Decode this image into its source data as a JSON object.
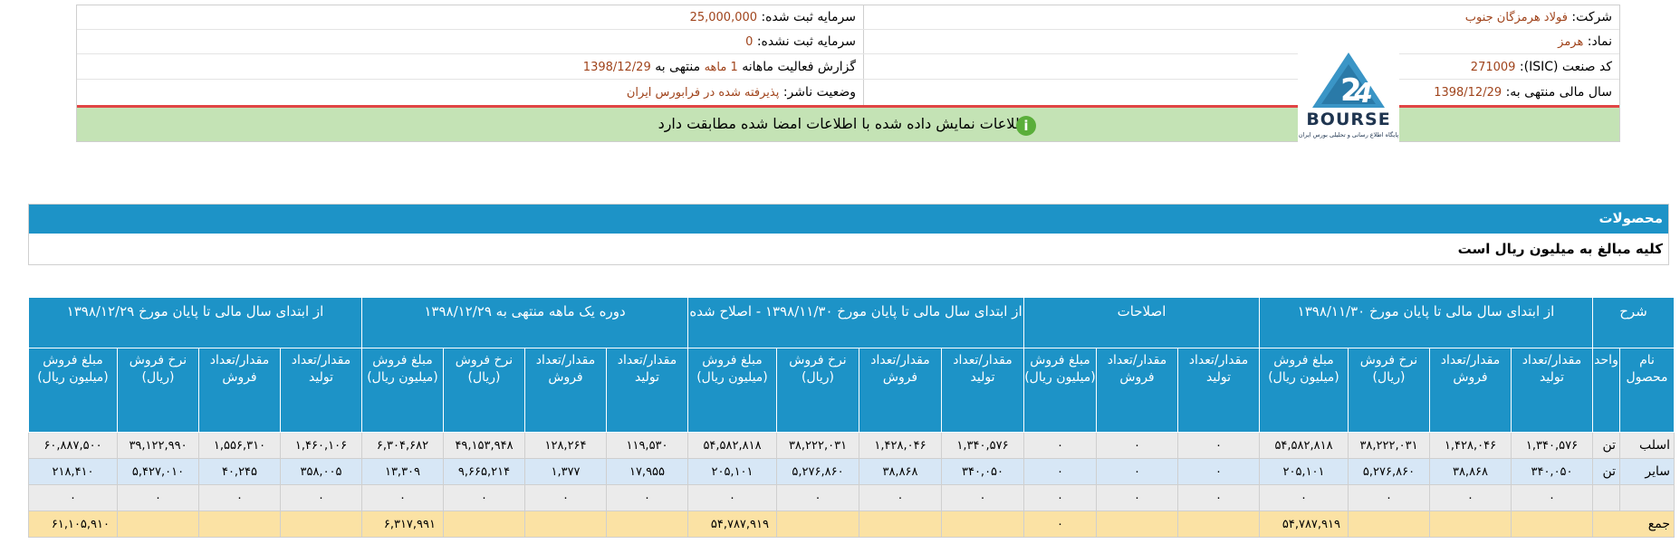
{
  "header": {
    "company_label": "شرکت:",
    "company_value": "فولاد هرمزگان جنوب",
    "symbol_label": "نماد:",
    "symbol_value": "هرمز",
    "isic_label": "کد صنعت (ISIC):",
    "isic_value": "271009",
    "fiscal_label": "سال مالی منتهی به:",
    "fiscal_value": "1398/12/29",
    "registered_capital_label": "سرمایه ثبت شده:",
    "registered_capital_value": "25,000,000",
    "unregistered_capital_label": "سرمایه ثبت نشده:",
    "unregistered_capital_value": "0",
    "report_prefix": "گزارش فعالیت ماهانه",
    "report_period": "1 ماهه",
    "report_mid": "منتهی به",
    "report_date": "1398/12/29",
    "publisher_label": "وضعیت ناشر:",
    "publisher_value": "پذیرفته شده در فرابورس ایران",
    "logo_text": "BOURSE",
    "logo_caption": "پایگاه اطلاع رسانی و تحلیلی بورس ایران",
    "notice": "اطلاعات نمایش داده شده با اطلاعات امضا شده مطابقت دارد",
    "notice_icon": "info-icon"
  },
  "products": {
    "title": "محصولات",
    "subtitle": "کلیه مبالغ به میلیون ریال است"
  },
  "colors": {
    "header_blue": "#1d93c7",
    "notice_green": "#c4e3b5",
    "accent_red": "#e04545",
    "value_brown": "#a0441c",
    "total_row": "#fbe2a4",
    "alt_row": "#d7e7f6"
  },
  "table": {
    "group_headers": [
      "شرح",
      "از ابتدای سال مالی تا پایان مورخ ۱۳۹۸/۱۱/۳۰",
      "اصلاحات",
      "از ابتدای سال مالی تا پایان مورخ ۱۳۹۸/۱۱/۳۰ - اصلاح شده",
      "دوره یک ماهه منتهی به ۱۳۹۸/۱۲/۲۹",
      "از ابتدای سال مالی تا پایان مورخ ۱۳۹۸/۱۲/۲۹"
    ],
    "sub_headers": [
      "نام محصول",
      "واحد",
      "مقدار/تعداد تولید",
      "مقدار/تعداد فروش",
      "نرخ فروش (ریال)",
      "مبلغ فروش (میلیون ریال)",
      "مقدار/تعداد تولید",
      "مقدار/تعداد فروش",
      "مبلغ فروش (میلیون ریال)",
      "مقدار/تعداد تولید",
      "مقدار/تعداد فروش",
      "نرخ فروش (ریال)",
      "مبلغ فروش (میلیون ریال)",
      "مقدار/تعداد تولید",
      "مقدار/تعداد فروش",
      "نرخ فروش (ریال)",
      "مبلغ فروش (میلیون ریال)",
      "مقدار/تعداد تولید",
      "مقدار/تعداد فروش",
      "نرخ فروش (ریال)",
      "مبلغ فروش (میلیون ریال)"
    ],
    "rows": [
      [
        "اسلب",
        "تن",
        "۱,۳۴۰,۵۷۶",
        "۱,۴۲۸,۰۴۶",
        "۳۸,۲۲۲,۰۳۱",
        "۵۴,۵۸۲,۸۱۸",
        "۰",
        "۰",
        "۰",
        "۱,۳۴۰,۵۷۶",
        "۱,۴۲۸,۰۴۶",
        "۳۸,۲۲۲,۰۳۱",
        "۵۴,۵۸۲,۸۱۸",
        "۱۱۹,۵۳۰",
        "۱۲۸,۲۶۴",
        "۴۹,۱۵۳,۹۴۸",
        "۶,۳۰۴,۶۸۲",
        "۱,۴۶۰,۱۰۶",
        "۱,۵۵۶,۳۱۰",
        "۳۹,۱۲۲,۹۹۰",
        "۶۰,۸۸۷,۵۰۰"
      ],
      [
        "سایر",
        "تن",
        "۳۴۰,۰۵۰",
        "۳۸,۸۶۸",
        "۵,۲۷۶,۸۶۰",
        "۲۰۵,۱۰۱",
        "۰",
        "۰",
        "۰",
        "۳۴۰,۰۵۰",
        "۳۸,۸۶۸",
        "۵,۲۷۶,۸۶۰",
        "۲۰۵,۱۰۱",
        "۱۷,۹۵۵",
        "۱,۳۷۷",
        "۹,۶۶۵,۲۱۴",
        "۱۳,۳۰۹",
        "۳۵۸,۰۰۵",
        "۴۰,۲۴۵",
        "۵,۴۲۷,۰۱۰",
        "۲۱۸,۴۱۰"
      ],
      [
        "",
        "",
        "۰",
        "۰",
        "۰",
        "۰",
        "۰",
        "۰",
        "۰",
        "۰",
        "۰",
        "۰",
        "۰",
        "۰",
        "۰",
        "۰",
        "۰",
        "۰",
        "۰",
        "۰",
        "۰"
      ]
    ],
    "total_label": "جمع",
    "totals": {
      "sales_1": "۵۴,۷۸۷,۹۱۹",
      "adj_sales": "۰",
      "sales_2": "۵۴,۷۸۷,۹۱۹",
      "sales_3": "۶,۳۱۷,۹۹۱",
      "sales_4": "۶۱,۱۰۵,۹۱۰"
    }
  }
}
